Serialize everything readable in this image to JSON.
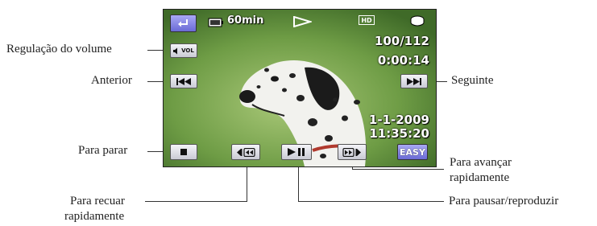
{
  "screen": {
    "battery_time": "60min",
    "quality_badge": "HD",
    "file_counter": "100/112",
    "time_code": "0:00:14",
    "date": "1-1-2009",
    "clock": "11:35:20",
    "vol_button_label": "VOL",
    "easy_button_label": "EASY"
  },
  "callouts": {
    "volume": "Regulação do volume",
    "previous": "Anterior",
    "next": "Seguinte",
    "stop": "Para parar",
    "fast_forward_line1": "Para avançar",
    "fast_forward_line2": "rapidamente",
    "rewind_line1": "Para recuar",
    "rewind_line2": "rapidamente",
    "pause_play": "Para pausar/reproduzir"
  },
  "icons": [
    "return-icon",
    "battery-icon",
    "play-indicator-icon",
    "hd-quality-icon",
    "disk-media-icon",
    "speaker-icon",
    "previous-icon",
    "next-icon",
    "stop-icon",
    "rewind-icon",
    "play-pause-icon",
    "fast-forward-icon"
  ]
}
